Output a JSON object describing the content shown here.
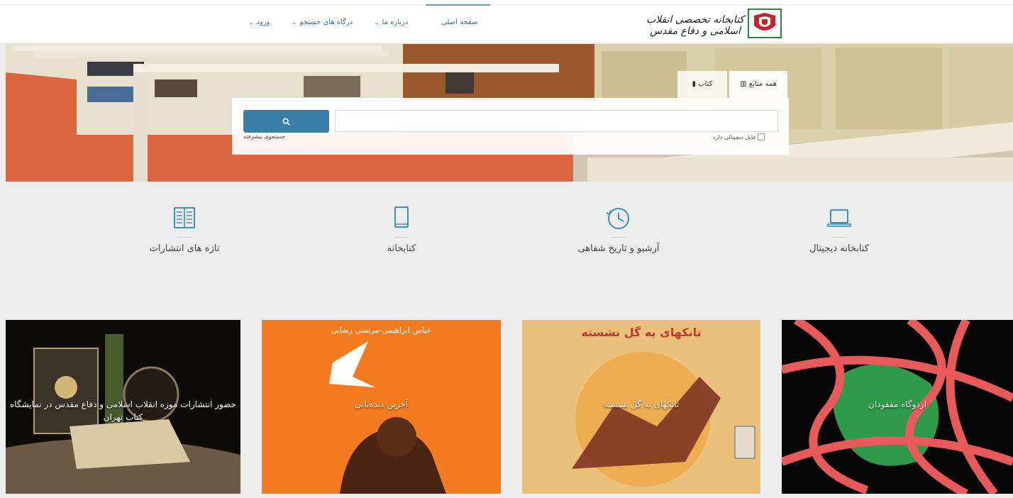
{
  "header": {
    "logo_text": "کتابخانه تخصصی انقلاب اسلامی و دفاع مقدس",
    "nav": [
      {
        "label": "صفحه اصلی",
        "active": true
      },
      {
        "label": "درباره ما",
        "dropdown": true
      },
      {
        "label": "درگاه های جستجو",
        "dropdown": true
      },
      {
        "label": "ورود",
        "dropdown": true
      }
    ]
  },
  "search": {
    "tabs": [
      {
        "label": "همه منابع",
        "icon": "library-icon",
        "active": true
      },
      {
        "label": "کتاب",
        "icon": "book-icon",
        "active": false
      }
    ],
    "input_value": "",
    "button_icon": "search-icon",
    "advanced_link": "جستجوی پیشرفته",
    "digital_checkbox_label": "فایل دیجیتالی دارد",
    "digital_checked": false
  },
  "features": [
    {
      "label": "کتابخانه دیجیتال",
      "icon": "laptop-icon"
    },
    {
      "label": "آرشیو و تاریخ شفاهی",
      "icon": "history-clock-icon"
    },
    {
      "label": "کتابخانه",
      "icon": "book-icon"
    },
    {
      "label": "تازه های انتشارات",
      "icon": "open-book-icon"
    }
  ],
  "cards": [
    {
      "title": "اردوگاه مفقودان"
    },
    {
      "title": "تانکهای به گل نشسته",
      "cover_text": "تانکهای به گل نشسته"
    },
    {
      "title": "آخرین دیده‌بانی",
      "cover_text": "عباس ابراهیمی-مرتضی رضایی"
    },
    {
      "title": "حضور انتشارات موزه انقلاب اسلامی و دفاع مقدس در نمایشگاه کتاب تهران"
    }
  ],
  "colors": {
    "accent": "#3a7fa6",
    "nav_text": "#2a6fa6",
    "icon": "#3b8fb8"
  }
}
